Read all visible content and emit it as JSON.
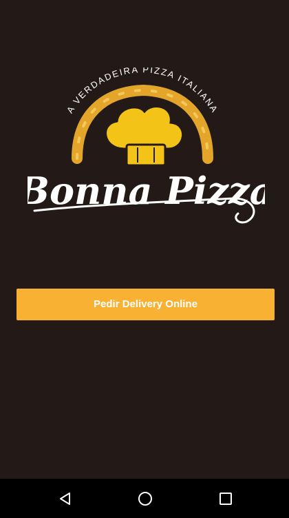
{
  "logo": {
    "arc_text": "A VERDADEIRA PIZZA ITALIANA",
    "brand_name": "Bonna Pizza"
  },
  "cta": {
    "label": "Pedir Delivery Online"
  },
  "navbar": {
    "back_icon": "back-icon",
    "home_icon": "home-icon",
    "recents_icon": "recents-icon"
  },
  "colors": {
    "background": "#231a17",
    "accent": "#f8b133",
    "logo_gold": "#f3c317",
    "crust": "#e3a62a",
    "navbar": "#000000"
  }
}
